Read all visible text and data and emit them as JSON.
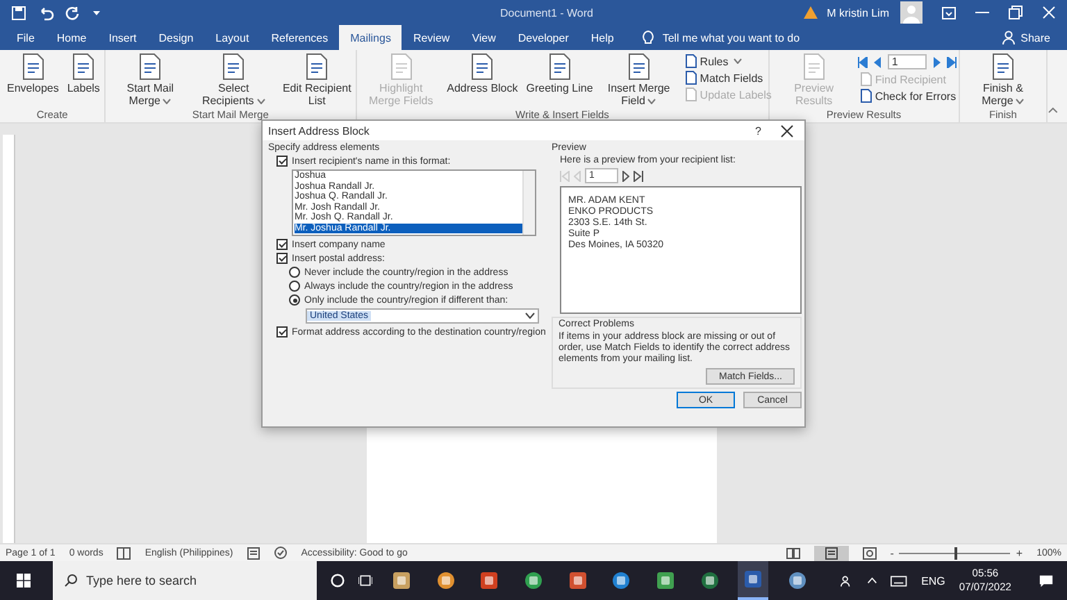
{
  "title_bar": {
    "document_title": "Document1  -  Word",
    "user": "M kristin Lim"
  },
  "tabs": [
    {
      "label": "File",
      "selected": false
    },
    {
      "label": "Home",
      "selected": false
    },
    {
      "label": "Insert",
      "selected": false
    },
    {
      "label": "Design",
      "selected": false
    },
    {
      "label": "Layout",
      "selected": false
    },
    {
      "label": "References",
      "selected": false
    },
    {
      "label": "Mailings",
      "selected": true
    },
    {
      "label": "Review",
      "selected": false
    },
    {
      "label": "View",
      "selected": false
    },
    {
      "label": "Developer",
      "selected": false
    },
    {
      "label": "Help",
      "selected": false
    }
  ],
  "tell_me": "Tell me what you want to do",
  "share": "Share",
  "ribbon": [
    {
      "label": "Create",
      "commands": [
        {
          "kind": "large",
          "label": "Envelopes",
          "disabled": false
        },
        {
          "kind": "large",
          "label": "Labels",
          "disabled": false
        }
      ]
    },
    {
      "label": "Start Mail Merge",
      "commands": [
        {
          "kind": "large",
          "label": "Start Mail Merge",
          "dropdown": true,
          "disabled": false
        },
        {
          "kind": "large",
          "label": "Select Recipients",
          "dropdown": true,
          "disabled": false
        },
        {
          "kind": "large",
          "label": "Edit Recipient List",
          "disabled": false
        }
      ]
    },
    {
      "label": "Write & Insert Fields",
      "commands": [
        {
          "kind": "large",
          "label": "Highlight Merge Fields",
          "disabled": true
        },
        {
          "kind": "large",
          "label": "Address Block",
          "disabled": false
        },
        {
          "kind": "large",
          "label": "Greeting Line",
          "disabled": false
        },
        {
          "kind": "large",
          "label": "Insert Merge Field",
          "dropdown": true,
          "disabled": false
        },
        {
          "kind": "small",
          "label": "Rules",
          "dropdown": true,
          "disabled": false
        },
        {
          "kind": "small",
          "label": "Match Fields",
          "disabled": false
        },
        {
          "kind": "small",
          "label": "Update Labels",
          "disabled": true
        }
      ]
    },
    {
      "label": "Preview Results",
      "commands": [
        {
          "kind": "large",
          "label": "Preview Results",
          "disabled": true
        },
        {
          "kind": "record",
          "label": "1"
        },
        {
          "kind": "small",
          "label": "Find Recipient",
          "disabled": true
        },
        {
          "kind": "small",
          "label": "Check for Errors",
          "disabled": false
        }
      ]
    },
    {
      "label": "Finish",
      "commands": [
        {
          "kind": "large",
          "label": "Finish & Merge",
          "dropdown": true,
          "disabled": false
        }
      ]
    }
  ],
  "dialog": {
    "title": "Insert Address Block",
    "help": "?",
    "specify": {
      "heading": "Specify address elements",
      "name_format": {
        "label": "Insert recipient's name in this format:",
        "checked": true,
        "options": [
          {
            "text": "Joshua",
            "selected": false
          },
          {
            "text": "Joshua Randall Jr.",
            "selected": false
          },
          {
            "text": "Joshua Q. Randall Jr.",
            "selected": false
          },
          {
            "text": "Mr. Josh Randall Jr.",
            "selected": false
          },
          {
            "text": "Mr. Josh Q. Randall Jr.",
            "selected": false
          },
          {
            "text": "Mr. Joshua Randall Jr.",
            "selected": true
          }
        ]
      },
      "company": {
        "label": "Insert company name",
        "checked": true
      },
      "postal": {
        "label": "Insert postal address:",
        "checked": true,
        "options": [
          {
            "label": "Never include the country/region in the address",
            "selected": false
          },
          {
            "label": "Always include the country/region in the address",
            "selected": false
          },
          {
            "label": "Only include the country/region if different than:",
            "selected": true
          }
        ],
        "country": "United States"
      },
      "format_by_country": {
        "label": "Format address according to the destination country/region",
        "checked": true
      }
    },
    "preview": {
      "heading": "Preview",
      "hint": "Here is a preview from your recipient list:",
      "record": "1",
      "address_lines": [
        "MR. ADAM KENT",
        "ENKO PRODUCTS",
        "2303 S.E. 14th St.",
        "Suite P",
        "Des Moines, IA 50320"
      ]
    },
    "correct": {
      "heading": "Correct Problems",
      "text": "If items in your address block are missing or out of order, use Match Fields to identify the correct address elements from your mailing list.",
      "button": "Match Fields..."
    },
    "buttons": [
      {
        "label": "OK",
        "default": true
      },
      {
        "label": "Cancel",
        "default": false
      }
    ]
  },
  "status_bar": {
    "page": "Page 1 of 1",
    "words": "0 words",
    "language": "English (Philippines)",
    "accessibility": "Accessibility: Good to go",
    "zoom_out": "-",
    "zoom_in": "+",
    "zoom": "100%",
    "zoom_slider": {
      "level": 0.5
    }
  },
  "taskbar": {
    "search_placeholder": "Type here to search",
    "language": "ENG",
    "time": "05:56",
    "date": "07/07/2022"
  }
}
